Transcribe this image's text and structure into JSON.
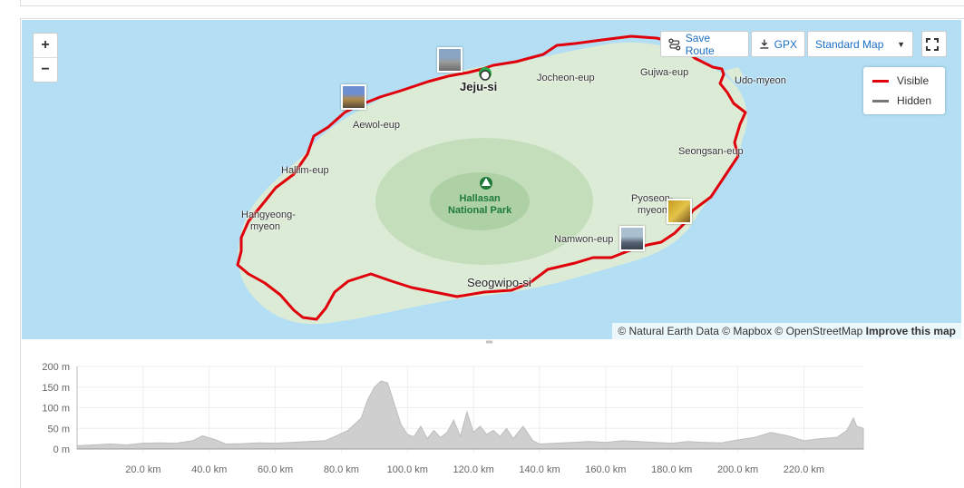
{
  "map": {
    "places": [
      {
        "id": "jeju-si",
        "label": "Jeju-si",
        "big": true
      },
      {
        "id": "jocheon",
        "label": "Jocheon-eup"
      },
      {
        "id": "gujwa",
        "label": "Gujwa-eup"
      },
      {
        "id": "udo",
        "label": "Udo-myeon"
      },
      {
        "id": "aewol",
        "label": "Aewol-eup"
      },
      {
        "id": "hallim",
        "label": "Hallim-eup"
      },
      {
        "id": "hangyeong1",
        "label": "Hangyeong-"
      },
      {
        "id": "hangyeong2",
        "label": "myeon"
      },
      {
        "id": "seongsan",
        "label": "Seongsan-eup"
      },
      {
        "id": "pyoseon1",
        "label": "Pyoseon-"
      },
      {
        "id": "pyoseon2",
        "label": "myeon"
      },
      {
        "id": "namwon",
        "label": "Namwon-eup"
      },
      {
        "id": "seogwipo",
        "label": "Seogwipo-si",
        "big": true
      }
    ],
    "park": {
      "line1": "Hallasan",
      "line2": "National Park",
      "icon": "tree-icon"
    },
    "zoom_in": "+",
    "zoom_out": "−",
    "attribution": {
      "text": "© Natural Earth Data © Mapbox © OpenStreetMap",
      "link": "Improve this map"
    },
    "route_color": "#e0000b",
    "water_color": "#b4def4",
    "land_color": "#dcebd6"
  },
  "toolbar": {
    "save_route": "Save Route",
    "gpx": "GPX",
    "map_style": "Standard Map"
  },
  "legend": {
    "visible": "Visible",
    "hidden": "Hidden",
    "visible_color": "#e0000b",
    "hidden_color": "#777777"
  },
  "chart_data": {
    "type": "area",
    "title": "",
    "xlabel": "",
    "ylabel": "",
    "y_ticks": [
      "200 m",
      "150 m",
      "100 m",
      "50 m",
      "0 m"
    ],
    "x_ticks": [
      "20.0 km",
      "40.0 km",
      "60.0 km",
      "80.0 km",
      "100.0 km",
      "120.0 km",
      "140.0 km",
      "160.0 km",
      "180.0 km",
      "200.0 km",
      "220.0 km"
    ],
    "xlim": [
      0,
      238
    ],
    "ylim": [
      0,
      200
    ],
    "x": [
      0,
      5,
      10,
      15,
      20,
      25,
      30,
      35,
      38,
      42,
      45,
      50,
      55,
      60,
      65,
      70,
      75,
      78,
      82,
      86,
      88,
      90,
      92,
      94,
      96,
      98,
      100,
      102,
      104,
      106,
      108,
      110,
      112,
      114,
      116,
      118,
      120,
      122,
      124,
      126,
      128,
      130,
      132,
      135,
      138,
      140,
      145,
      150,
      155,
      160,
      165,
      170,
      175,
      180,
      185,
      190,
      195,
      200,
      205,
      210,
      215,
      220,
      225,
      230,
      233,
      235,
      236,
      238
    ],
    "y": [
      8,
      10,
      12,
      10,
      14,
      15,
      14,
      20,
      32,
      22,
      12,
      13,
      15,
      14,
      16,
      18,
      20,
      30,
      45,
      75,
      120,
      150,
      165,
      160,
      110,
      60,
      35,
      30,
      55,
      25,
      45,
      28,
      40,
      70,
      30,
      90,
      40,
      55,
      35,
      45,
      30,
      50,
      25,
      55,
      20,
      12,
      14,
      16,
      18,
      16,
      20,
      18,
      16,
      14,
      18,
      16,
      15,
      22,
      28,
      40,
      32,
      20,
      25,
      28,
      45,
      75,
      55,
      50
    ]
  }
}
